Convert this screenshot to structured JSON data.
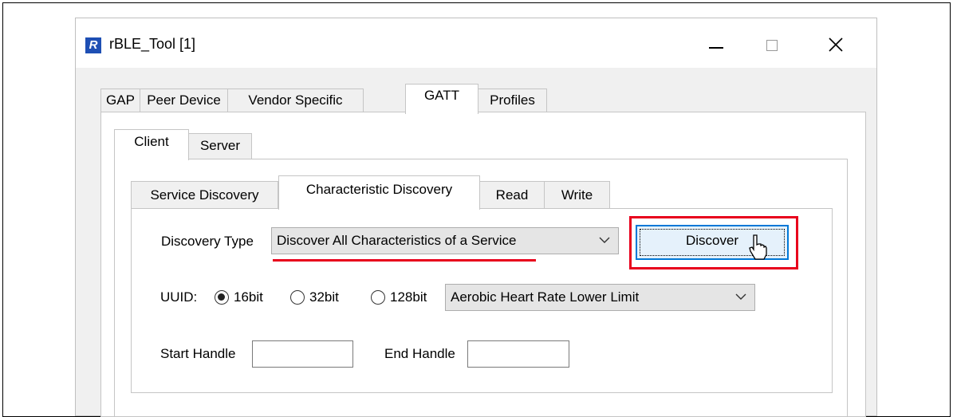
{
  "window": {
    "title": "rBLE_Tool [1]",
    "app_icon_letter": "R"
  },
  "tabs_level1": [
    {
      "label": "GAP",
      "active": false
    },
    {
      "label": "Peer Device",
      "active": false
    },
    {
      "label": "Vendor Specific",
      "active": false
    },
    {
      "label": "GATT",
      "active": true
    },
    {
      "label": "Profiles",
      "active": false
    }
  ],
  "tabs_level2": [
    {
      "label": "Client",
      "active": true
    },
    {
      "label": "Server",
      "active": false
    }
  ],
  "tabs_level3": [
    {
      "label": "Service Discovery",
      "active": false
    },
    {
      "label": "Characteristic Discovery",
      "active": true
    },
    {
      "label": "Read",
      "active": false
    },
    {
      "label": "Write",
      "active": false
    }
  ],
  "form": {
    "discovery_type_label": "Discovery Type",
    "discovery_type_value": "Discover All Characteristics of a Service",
    "discover_button": "Discover",
    "uuid_label": "UUID:",
    "uuid_options": [
      {
        "label": "16bit",
        "selected": true
      },
      {
        "label": "32bit",
        "selected": false
      },
      {
        "label": "128bit",
        "selected": false
      }
    ],
    "uuid_value": "Aerobic Heart Rate Lower Limit",
    "start_handle_label": "Start Handle",
    "start_handle_value": "",
    "end_handle_label": "End Handle",
    "end_handle_value": ""
  },
  "highlight_color": "#e8001c"
}
